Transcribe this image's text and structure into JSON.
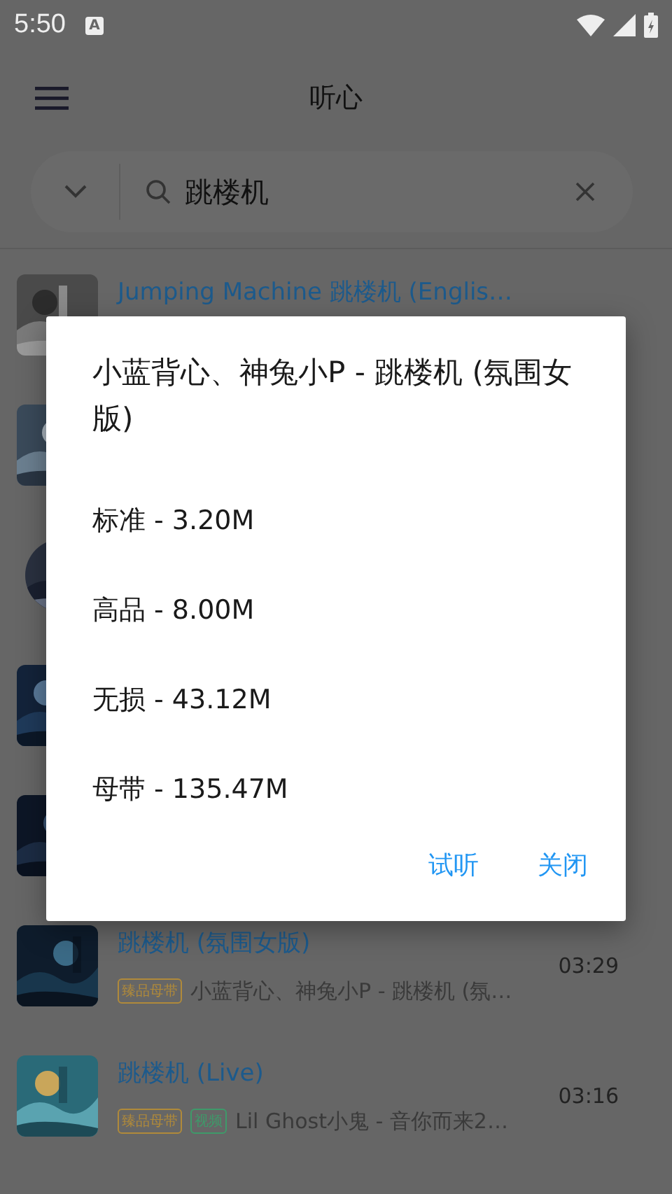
{
  "status_bar": {
    "time": "5:50",
    "notification_letter": "A"
  },
  "app_bar": {
    "title": "听心"
  },
  "search": {
    "value": "跳楼机"
  },
  "results": [
    {
      "title": "Jumping Machine 跳楼机 (Englis…",
      "thumbnail": {
        "kind": "picture"
      }
    },
    {
      "thumbnail": {
        "kind": "picture"
      }
    },
    {
      "thumbnail": {
        "kind": "round_picture"
      }
    },
    {
      "thumbnail": {
        "kind": "picture"
      }
    },
    {
      "thumbnail": {
        "kind": "picture"
      }
    },
    {
      "title": "跳楼机 (氛围女版)",
      "time": "03:29",
      "tags": [
        {
          "label": "臻品母带",
          "color": "#b08a3a"
        }
      ],
      "subtitle": "小蓝背心、神兔小P - 跳楼机 (氛…",
      "thumbnail": {
        "kind": "picture"
      }
    },
    {
      "title": "跳楼机 (Live)",
      "time": "03:16",
      "tags": [
        {
          "label": "臻品母带",
          "color": "#b08a3a"
        },
        {
          "label": "视频",
          "color": "#3e9a6a"
        }
      ],
      "subtitle": "Lil Ghost小鬼 - 音你而来2…",
      "thumbnail": {
        "kind": "picture"
      }
    }
  ],
  "dialog": {
    "title": "小蓝背心、神兔小P - 跳楼机 (氛围女版)",
    "options": [
      "标准 - 3.20M",
      "高品 - 8.00M",
      "无损 - 43.12M",
      "母带 - 135.47M"
    ],
    "buttons": [
      "试听",
      "关闭"
    ]
  }
}
